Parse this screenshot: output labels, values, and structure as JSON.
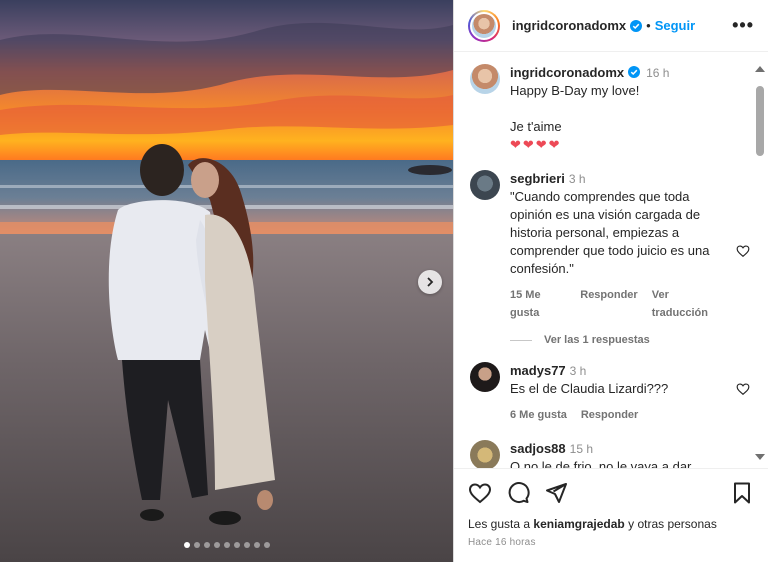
{
  "post": {
    "author": "ingridcoronadomx",
    "separator": "•",
    "follow_label": "Seguir",
    "more_label": "•••",
    "slide_count": 9,
    "active_slide": 1
  },
  "caption": {
    "username": "ingridcoronadomx",
    "time": "16 h",
    "text": "Happy B-Day my love!\n\nJe t'aime",
    "hearts": "❤❤❤❤"
  },
  "comments": [
    {
      "username": "segbrieri",
      "time": "3 h",
      "text": "\"Cuando comprendes que toda opinión es una visión cargada de historia personal, empiezas a comprender que todo juicio es una confesión.\"",
      "likes": "15 Me gusta",
      "reply": "Responder",
      "translate": "Ver traducción",
      "view_replies": "Ver las 1 respuestas"
    },
    {
      "username": "madys77",
      "time": "3 h",
      "text": "Es el de Claudia Lizardi???",
      "likes": "6 Me gusta",
      "reply": "Responder"
    },
    {
      "username": "sadjos88",
      "time": "15 h",
      "text": "Q no le de frio, no le vaya a dar"
    }
  ],
  "footer": {
    "likes_prefix": "Les gusta a",
    "likes_user": "keniamgrajedab",
    "likes_suffix": "y otras personas",
    "timestamp": "Hace 16 horas"
  },
  "icons": {
    "like": "heart-icon",
    "comment": "comment-icon",
    "share": "send-icon",
    "save": "bookmark-icon",
    "next": "chevron-right-icon"
  },
  "colors": {
    "accent": "#0095f6",
    "heart": "#ed4956",
    "muted": "#737373"
  }
}
